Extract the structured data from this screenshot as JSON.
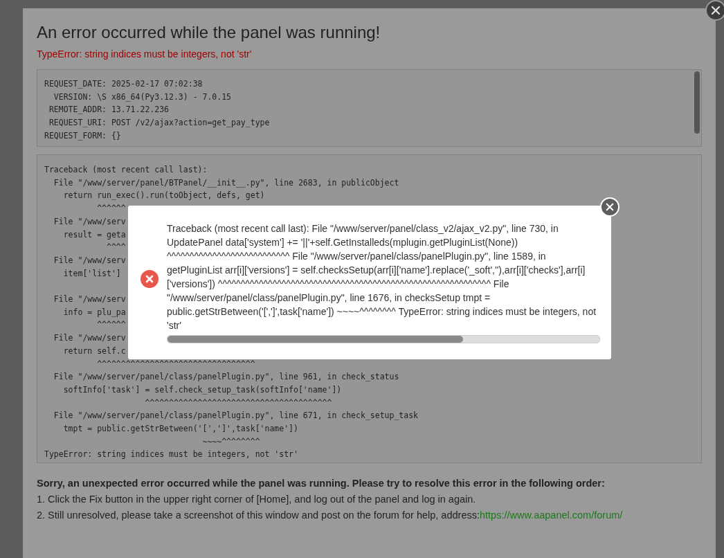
{
  "dialog": {
    "title": "An error occurred while the panel was running!",
    "error": "TypeError: string indices must be integers, not 'str'",
    "request_lines": [
      "REQUEST_DATE: 2025-02-17 07:02:38",
      "  VERSION: \\S x86_64(Py3.12.3) - 7.0.15",
      " REMOTE_ADDR: 13.71.22.236",
      " REQUEST_URI: POST /v2/ajax?action=get_pay_type",
      "REQUEST_FORM: {}"
    ],
    "traceback": {
      "header": "Traceback (most recent call last):",
      "frames": [
        {
          "file": "  File \"/www/server/panel/BTPanel/__init__.py\", line 2683, in publicObject",
          "code": "    return run_exec().run(toObject, defs, get)",
          "marker": "           ^^^^^^"
        },
        {
          "file": "  File \"/www/serv",
          "code": "    result = geta",
          "marker": "             ^^^^"
        },
        {
          "file": "  File \"/www/serv",
          "code": "    item['list']"
        },
        {
          "file": "  File \"/www/serv",
          "code": "    info = plu_pa",
          "marker": "           ^^^^^^"
        },
        {
          "file": "  File \"/www/serv",
          "code": "    return self.c",
          "marker": "           ^^^^^^^^^^^^^^^^^^^^^^^^^^^^^^^^^"
        },
        {
          "file": "  File \"/www/server/panel/class/panelPlugin.py\", line 961, in check_status",
          "code": "    softInfo['task'] = self.check_setup_task(softInfo['name'])",
          "marker": "                     ^^^^^^^^^^^^^^^^^^^^^^^^^^^^^^^^^^^^^^^"
        },
        {
          "file": "  File \"/www/server/panel/class/panelPlugin.py\", line 671, in check_setup_task",
          "code": "    tmpt = public.getStrBetween('[',']',task['name'])",
          "marker": "                                 ~~~~^^^^^^^^"
        }
      ],
      "footer": "TypeError: string indices must be integers, not 'str'"
    },
    "help_heading": "Sorry, an unexpected error occurred while the panel was running. Please try to resolve this error in the following order:",
    "help_steps": [
      {
        "text": "1. Click the Fix button in the upper right corner of [Home], and log out of the panel and log in again."
      },
      {
        "text": "2. Still unresolved, please take a screenshot of this window and post on the forum for help, address:",
        "link": "https://www.aapanel.com/forum/"
      }
    ]
  },
  "toast": {
    "message": "Traceback (most recent call last): File \"/www/server/panel/class_v2/ajax_v2.py\", line 730, in UpdatePanel data['system'] += '||'+self.GetInstalleds(mplugin.getPluginList(None)) ^^^^^^^^^^^^^^^^^^^^^^^^^^^ File \"/www/server/panel/class/panelPlugin.py\", line 1589, in getPluginList arr[i]['versions'] = self.checksSetup(arr[i]['name'].replace('_soft',''),arr[i]['checks'],arr[i]['versions']) ^^^^^^^^^^^^^^^^^^^^^^^^^^^^^^^^^^^^^^^^^^^^^^^^^^^^^^^^^^^^ File \"/www/server/panel/class/panelPlugin.py\", line 1676, in checksSetup tmpt = public.getStrBetween('[',']',task['name']) ~~~~^^^^^^^^ TypeError: string indices must be integers, not 'str'",
    "level": 0.685
  }
}
